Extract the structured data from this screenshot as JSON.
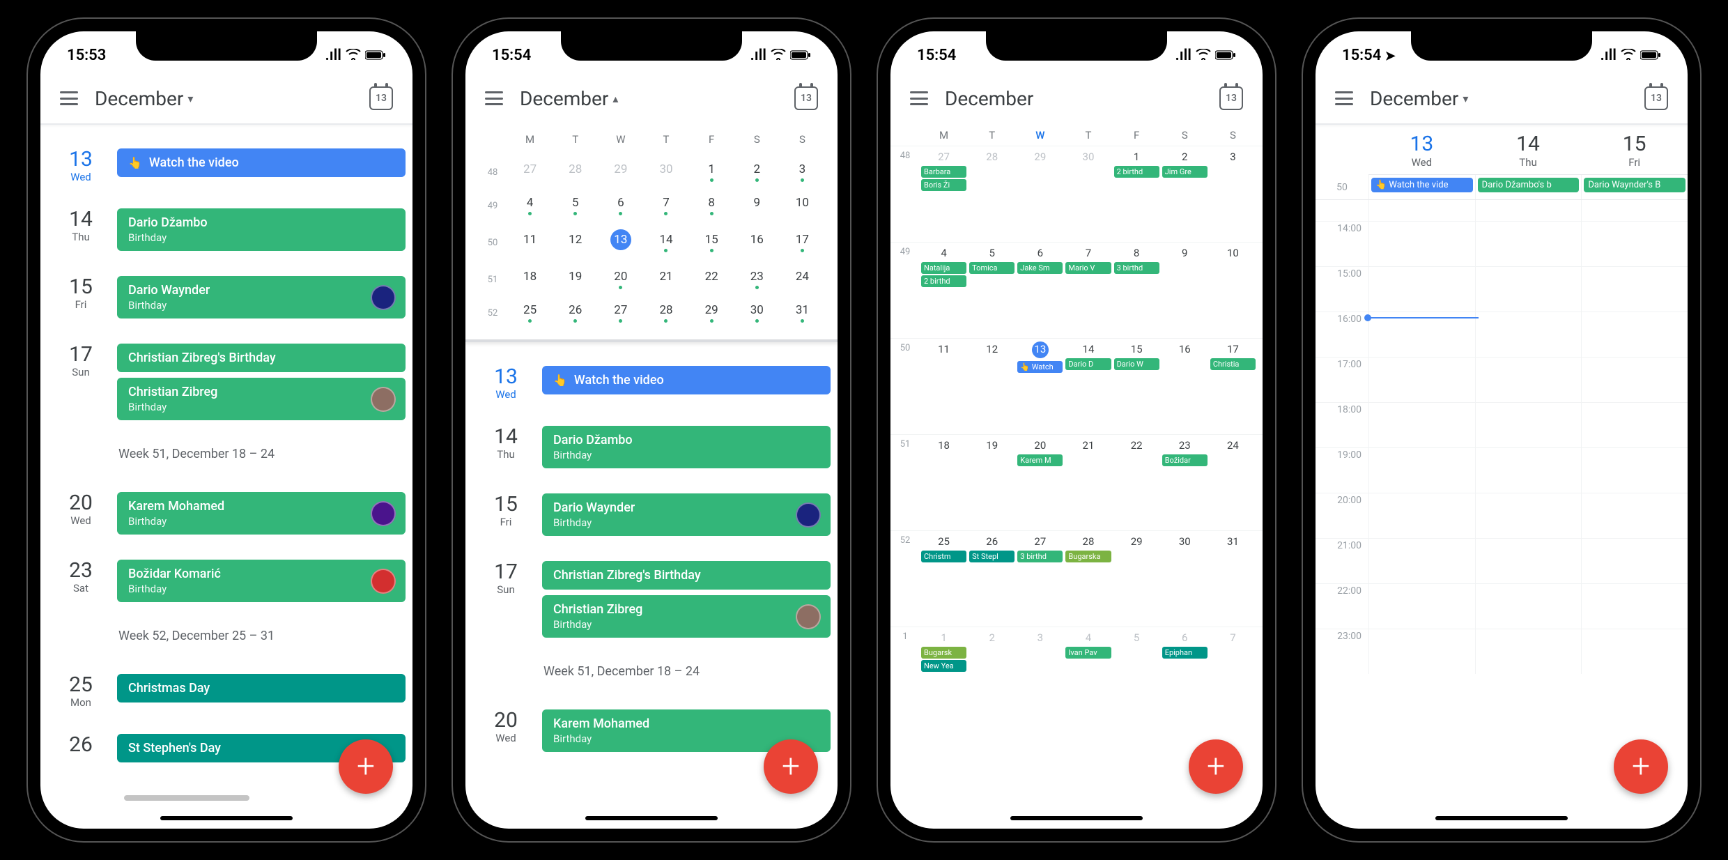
{
  "screens": [
    {
      "time": "15:53",
      "month": "December",
      "chevron": "▾",
      "today_num": "13",
      "has_location": false
    },
    {
      "time": "15:54",
      "month": "December",
      "chevron": "▴",
      "today_num": "13",
      "has_location": false
    },
    {
      "time": "15:54",
      "month": "December",
      "chevron": "",
      "today_num": "13",
      "has_location": false
    },
    {
      "time": "15:54",
      "month": "December",
      "chevron": "▾",
      "today_num": "13",
      "has_location": true
    }
  ],
  "schedule": [
    {
      "day_num": "13",
      "dow": "Wed",
      "today": true,
      "events": [
        {
          "title": "Watch the video",
          "color": "blue",
          "tap": true
        }
      ]
    },
    {
      "day_num": "14",
      "dow": "Thu",
      "events": [
        {
          "title": "Dario Džambo",
          "sub": "Birthday",
          "color": "green"
        }
      ]
    },
    {
      "day_num": "15",
      "dow": "Fri",
      "events": [
        {
          "title": "Dario Waynder",
          "sub": "Birthday",
          "color": "green",
          "avatar": true,
          "avatar_bg": "#1a237e"
        }
      ]
    },
    {
      "day_num": "17",
      "dow": "Sun",
      "events": [
        {
          "title": "Christian Zibreg's Birthday",
          "color": "green"
        },
        {
          "title": "Christian Zibreg",
          "sub": "Birthday",
          "color": "green",
          "avatar": true,
          "avatar_bg": "#8d6e63"
        }
      ]
    },
    {
      "week_header": "Week 51, December 18 – 24"
    },
    {
      "day_num": "20",
      "dow": "Wed",
      "events": [
        {
          "title": "Karem Mohamed",
          "sub": "Birthday",
          "color": "green",
          "avatar": true,
          "avatar_bg": "#4a148c"
        }
      ]
    },
    {
      "day_num": "23",
      "dow": "Sat",
      "events": [
        {
          "title": "Božidar Komarić",
          "sub": "Birthday",
          "color": "green",
          "avatar": true,
          "avatar_bg": "#d32f2f"
        }
      ]
    },
    {
      "week_header": "Week 52, December 25 – 31"
    },
    {
      "day_num": "25",
      "dow": "Mon",
      "events": [
        {
          "title": "Christmas Day",
          "color": "teal"
        }
      ]
    },
    {
      "day_num": "26",
      "dow": "",
      "events": [
        {
          "title": "St Stephen's Day",
          "color": "teal"
        }
      ]
    }
  ],
  "mini_month": {
    "dow_labels": [
      "M",
      "T",
      "W",
      "T",
      "F",
      "S",
      "S"
    ],
    "rows": [
      {
        "wk": "48",
        "days": [
          {
            "n": "27",
            "faded": true
          },
          {
            "n": "28",
            "faded": true
          },
          {
            "n": "29",
            "faded": true
          },
          {
            "n": "30",
            "faded": true
          },
          {
            "n": "1",
            "dot": true
          },
          {
            "n": "2",
            "dot": true
          },
          {
            "n": "3",
            "dot": true
          }
        ]
      },
      {
        "wk": "49",
        "days": [
          {
            "n": "4",
            "dot": true
          },
          {
            "n": "5",
            "dot": true
          },
          {
            "n": "6",
            "dot": true
          },
          {
            "n": "7",
            "dot": true
          },
          {
            "n": "8",
            "dot": true
          },
          {
            "n": "9"
          },
          {
            "n": "10"
          }
        ]
      },
      {
        "wk": "50",
        "days": [
          {
            "n": "11"
          },
          {
            "n": "12"
          },
          {
            "n": "13",
            "today": true
          },
          {
            "n": "14",
            "dot": true
          },
          {
            "n": "15",
            "dot": true
          },
          {
            "n": "16"
          },
          {
            "n": "17",
            "dot": true
          }
        ]
      },
      {
        "wk": "51",
        "days": [
          {
            "n": "18"
          },
          {
            "n": "19"
          },
          {
            "n": "20",
            "dot": true
          },
          {
            "n": "21"
          },
          {
            "n": "22"
          },
          {
            "n": "23",
            "dot": true
          },
          {
            "n": "24"
          }
        ]
      },
      {
        "wk": "52",
        "days": [
          {
            "n": "25",
            "dot": true
          },
          {
            "n": "26",
            "dot": true
          },
          {
            "n": "27",
            "dot": true
          },
          {
            "n": "28",
            "dot": true
          },
          {
            "n": "29",
            "dot": true
          },
          {
            "n": "30",
            "dot": true
          },
          {
            "n": "31",
            "dot": true
          }
        ]
      }
    ]
  },
  "mini_schedule": [
    {
      "day_num": "13",
      "dow": "Wed",
      "today": true,
      "events": [
        {
          "title": "Watch the video",
          "color": "blue",
          "tap": true
        }
      ]
    },
    {
      "day_num": "14",
      "dow": "Thu",
      "events": [
        {
          "title": "Dario Džambo",
          "sub": "Birthday",
          "color": "green"
        }
      ]
    },
    {
      "day_num": "15",
      "dow": "Fri",
      "events": [
        {
          "title": "Dario Waynder",
          "sub": "Birthday",
          "color": "green",
          "avatar": true,
          "avatar_bg": "#1a237e"
        }
      ]
    },
    {
      "day_num": "17",
      "dow": "Sun",
      "events": [
        {
          "title": "Christian Zibreg's Birthday",
          "color": "green"
        },
        {
          "title": "Christian Zibreg",
          "sub": "Birthday",
          "color": "green",
          "avatar": true,
          "avatar_bg": "#8d6e63"
        }
      ]
    },
    {
      "week_header": "Week 51, December 18 – 24"
    },
    {
      "day_num": "20",
      "dow": "Wed",
      "events": [
        {
          "title": "Karem Mohamed",
          "sub": "Birthday",
          "color": "green"
        }
      ]
    }
  ],
  "month_grid": {
    "dow_labels": [
      "M",
      "T",
      "W",
      "T",
      "F",
      "S",
      "S"
    ],
    "today_col": 2,
    "weeks": [
      {
        "wk": "48",
        "days": [
          {
            "n": "27",
            "faded": true,
            "chips": [
              {
                "t": "Barbara",
                "c": "green"
              },
              {
                "t": "Boris Ži",
                "c": "green"
              }
            ]
          },
          {
            "n": "28",
            "faded": true
          },
          {
            "n": "29",
            "faded": true
          },
          {
            "n": "30",
            "faded": true
          },
          {
            "n": "1",
            "chips": [
              {
                "t": "2 birthd",
                "c": "green"
              }
            ]
          },
          {
            "n": "2",
            "chips": [
              {
                "t": "Jim Gre",
                "c": "green"
              }
            ]
          },
          {
            "n": "3"
          }
        ]
      },
      {
        "wk": "49",
        "days": [
          {
            "n": "4",
            "chips": [
              {
                "t": "Natalija",
                "c": "green"
              },
              {
                "t": "2 birthd",
                "c": "green"
              }
            ]
          },
          {
            "n": "5",
            "chips": [
              {
                "t": "Tomica",
                "c": "green"
              }
            ]
          },
          {
            "n": "6",
            "chips": [
              {
                "t": "Jake Sm",
                "c": "green"
              }
            ]
          },
          {
            "n": "7",
            "chips": [
              {
                "t": "Mario V",
                "c": "green"
              }
            ]
          },
          {
            "n": "8",
            "chips": [
              {
                "t": "3 birthd",
                "c": "green"
              }
            ]
          },
          {
            "n": "9"
          },
          {
            "n": "10"
          }
        ]
      },
      {
        "wk": "50",
        "days": [
          {
            "n": "11"
          },
          {
            "n": "12"
          },
          {
            "n": "13",
            "today": true,
            "chips": [
              {
                "t": "👆 Watch",
                "c": "blue"
              }
            ]
          },
          {
            "n": "14",
            "chips": [
              {
                "t": "Dario D",
                "c": "green"
              }
            ]
          },
          {
            "n": "15",
            "chips": [
              {
                "t": "Dario W",
                "c": "green"
              }
            ]
          },
          {
            "n": "16"
          },
          {
            "n": "17",
            "chips": [
              {
                "t": "Christia",
                "c": "green"
              }
            ]
          }
        ]
      },
      {
        "wk": "51",
        "days": [
          {
            "n": "18"
          },
          {
            "n": "19"
          },
          {
            "n": "20",
            "chips": [
              {
                "t": "Karem M",
                "c": "green"
              }
            ]
          },
          {
            "n": "21"
          },
          {
            "n": "22"
          },
          {
            "n": "23",
            "chips": [
              {
                "t": "Božidar",
                "c": "green"
              }
            ]
          },
          {
            "n": "24"
          }
        ]
      },
      {
        "wk": "52",
        "days": [
          {
            "n": "25",
            "chips": [
              {
                "t": "Christm",
                "c": "teal"
              }
            ]
          },
          {
            "n": "26",
            "chips": [
              {
                "t": "St Stepl",
                "c": "teal"
              }
            ]
          },
          {
            "n": "27",
            "chips": [
              {
                "t": "3 birthd",
                "c": "green"
              }
            ]
          },
          {
            "n": "28",
            "chips": [
              {
                "t": "Bugarska",
                "c": "lime",
                "span": 4
              }
            ]
          },
          {
            "n": "29"
          },
          {
            "n": "30"
          },
          {
            "n": "31"
          }
        ]
      },
      {
        "wk": "1",
        "days": [
          {
            "n": "1",
            "faded": true,
            "chips": [
              {
                "t": "Bugarsk",
                "c": "lime"
              },
              {
                "t": "New Yea",
                "c": "teal"
              }
            ]
          },
          {
            "n": "2",
            "faded": true
          },
          {
            "n": "3",
            "faded": true
          },
          {
            "n": "4",
            "faded": true,
            "chips": [
              {
                "t": "Ivan Pav",
                "c": "green"
              }
            ]
          },
          {
            "n": "5",
            "faded": true
          },
          {
            "n": "6",
            "faded": true,
            "chips": [
              {
                "t": "Epiphan",
                "c": "teal"
              }
            ]
          },
          {
            "n": "7",
            "faded": true
          }
        ]
      }
    ]
  },
  "dayview": {
    "week_num": "50",
    "days": [
      {
        "num": "13",
        "dow": "Wed",
        "today": true,
        "allday": {
          "t": "👆 Watch the vide",
          "c": "blue"
        }
      },
      {
        "num": "14",
        "dow": "Thu",
        "allday": {
          "t": "Dario Džambo's b",
          "c": "green"
        }
      },
      {
        "num": "15",
        "dow": "Fri",
        "allday": {
          "t": "Dario Waynder's B",
          "c": "green"
        }
      }
    ],
    "hours": [
      "14:00",
      "15:00",
      "16:00",
      "17:00",
      "18:00",
      "19:00",
      "20:00",
      "21:00",
      "22:00",
      "23:00"
    ]
  }
}
